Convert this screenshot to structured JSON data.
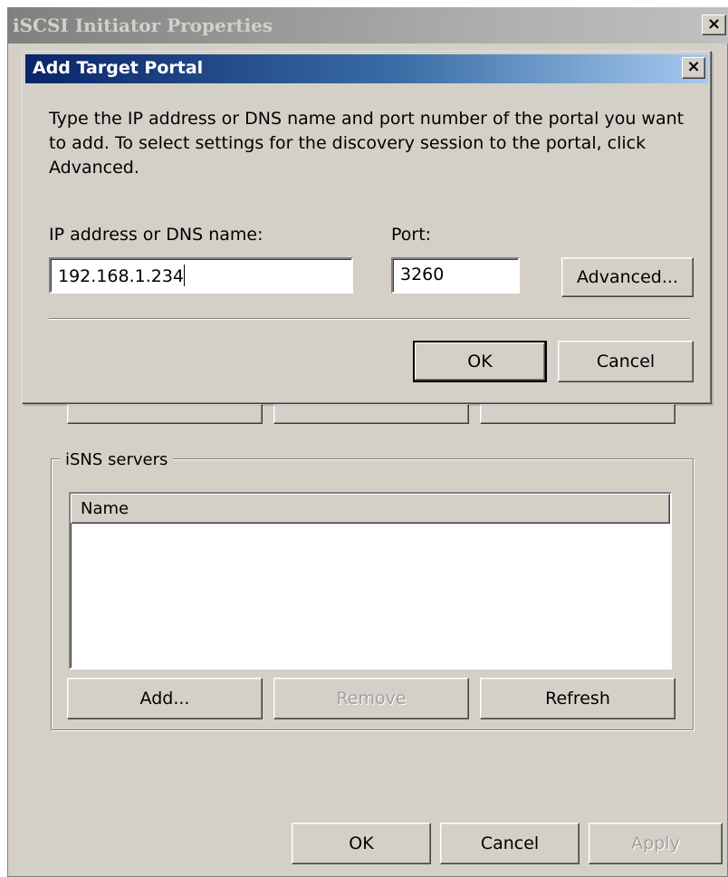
{
  "parent": {
    "title": "iSCSI Initiator Properties",
    "close_glyph": "×",
    "isns_group_label": "iSNS servers",
    "isns_column_name": "Name",
    "isns_add": "Add...",
    "isns_remove": "Remove",
    "isns_refresh": "Refresh",
    "ok": "OK",
    "cancel": "Cancel",
    "apply": "Apply"
  },
  "modal": {
    "title": "Add Target Portal",
    "close_glyph": "×",
    "description": "Type the IP address or DNS name and port number of the portal you want to add. To select settings for the discovery session to the portal, click Advanced.",
    "ip_label": "IP address or DNS name:",
    "ip_value": "192.168.1.234",
    "port_label": "Port:",
    "port_value": "3260",
    "advanced": "Advanced...",
    "ok": "OK",
    "cancel": "Cancel"
  }
}
